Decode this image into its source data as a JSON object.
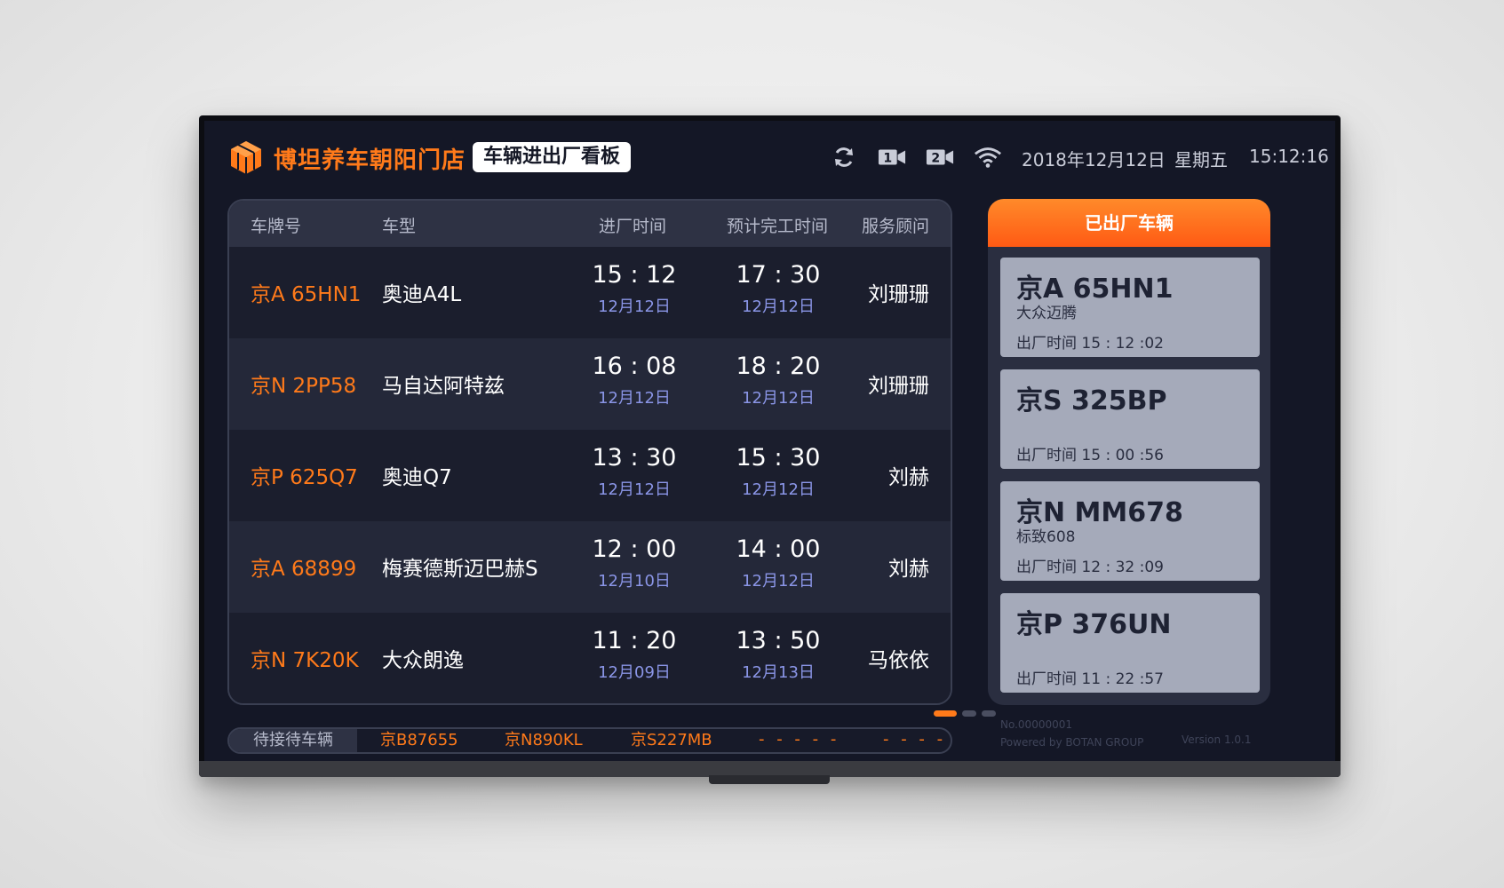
{
  "header": {
    "store_name": "博坦养车朝阳门店",
    "board_title": "车辆进出厂看板",
    "date": "2018年12月12日",
    "weekday": "星期五",
    "time": "15:12:16",
    "icons": [
      "refresh-icon",
      "camera-1-icon",
      "camera-2-icon",
      "wifi-icon"
    ],
    "camera_1_label": "1",
    "camera_2_label": "2"
  },
  "table": {
    "columns": [
      "车牌号",
      "车型",
      "进厂时间",
      "预计完工时间",
      "服务顾问"
    ],
    "rows": [
      {
        "plate": "京A 65HN1",
        "model": "奥迪A4L",
        "in_time": "15 : 12",
        "in_date": "12月12日",
        "out_time": "17 : 30",
        "out_date": "12月12日",
        "advisor": "刘珊珊"
      },
      {
        "plate": "京N 2PP58",
        "model": "马自达阿特兹",
        "in_time": "16 : 08",
        "in_date": "12月12日",
        "out_time": "18 : 20",
        "out_date": "12月12日",
        "advisor": "刘珊珊"
      },
      {
        "plate": "京P 625Q7",
        "model": "奥迪Q7",
        "in_time": "13 : 30",
        "in_date": "12月12日",
        "out_time": "15 : 30",
        "out_date": "12月12日",
        "advisor": "刘赫"
      },
      {
        "plate": "京A 68899",
        "model": "梅赛德斯迈巴赫S",
        "in_time": "12 : 00",
        "in_date": "12月10日",
        "out_time": "14 : 00",
        "out_date": "12月12日",
        "advisor": "刘赫"
      },
      {
        "plate": "京N 7K20K",
        "model": "大众朗逸",
        "in_time": "11 : 20",
        "in_date": "12月09日",
        "out_time": "13 : 50",
        "out_date": "12月13日",
        "advisor": "马依依"
      }
    ]
  },
  "pagination": {
    "pages": 3,
    "current": 1
  },
  "waiting": {
    "label": "待接待车辆",
    "items": [
      "京B87655",
      "京N890KL",
      "京S227MB"
    ],
    "placeholders": [
      "- - - - -",
      "- - - - -"
    ]
  },
  "exited": {
    "title": "已出厂车辆",
    "cards": [
      {
        "plate": "京A 65HN1",
        "model": "大众迈腾",
        "time": "出厂时间 15 : 12 :02"
      },
      {
        "plate": "京S 325BP",
        "model": "",
        "time": "出厂时间 15 : 00 :56"
      },
      {
        "plate": "京N MM678",
        "model": "标致608",
        "time": "出厂时间 12 : 32 :09"
      },
      {
        "plate": "京P 376UN",
        "model": "",
        "time": "出厂时间 11 : 22 :57"
      }
    ]
  },
  "footer": {
    "number": "No.00000001",
    "powered_by": "Powered by BOTAN GROUP",
    "version": "Version 1.0.1"
  },
  "colors": {
    "accent": "#ff7a1a",
    "screen_bg": "#141726",
    "date_text": "#8a95e6",
    "card_bg": "#a5aaba"
  }
}
